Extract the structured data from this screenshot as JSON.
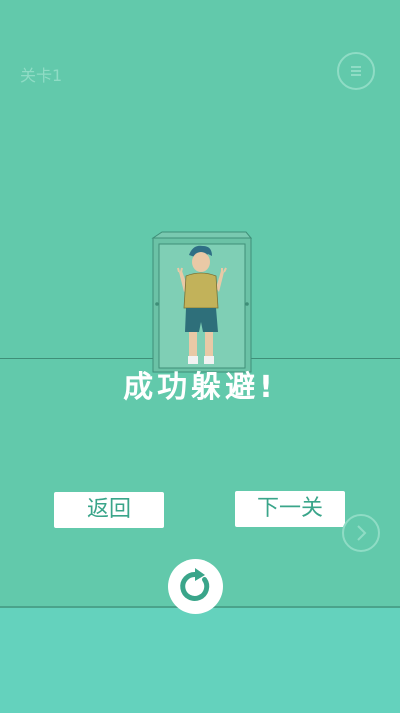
{
  "level": {
    "label": "关卡1"
  },
  "icons": {
    "menu": "menu-icon",
    "next": "chevron-right-icon",
    "replay": "replay-icon"
  },
  "result": {
    "text": "成功躲避!"
  },
  "buttons": {
    "back_label": "返回",
    "next_label": "下一关"
  },
  "colors": {
    "background": "#62c9ab",
    "ground": "#64d2bd",
    "button_text": "#3aa58a"
  }
}
